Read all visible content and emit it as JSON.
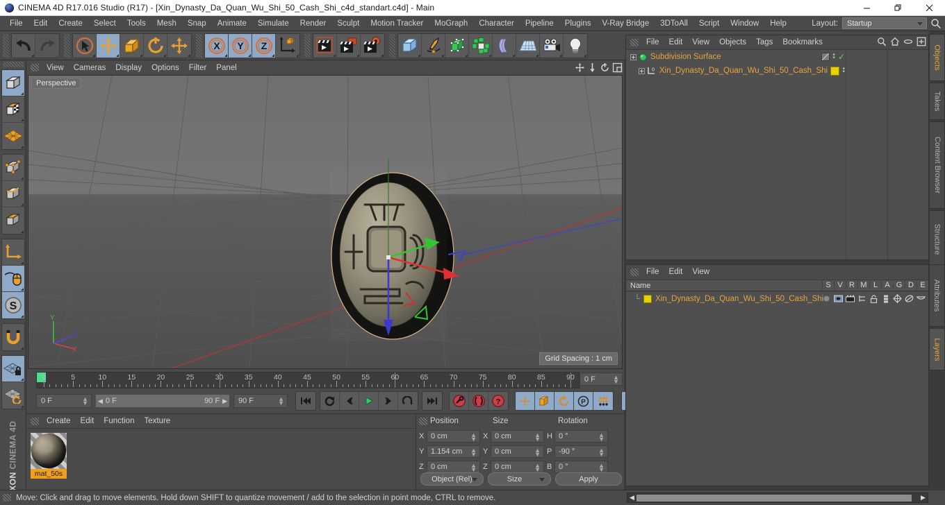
{
  "window": {
    "title": "CINEMA 4D R17.016 Studio (R17) - [Xin_Dynasty_Da_Quan_Wu_Shi_50_Cash_Shi_c4d_standart.c4d] - Main",
    "minimize": "—",
    "maximize": "❐",
    "close": "✕"
  },
  "menubar": {
    "items": [
      "File",
      "Edit",
      "Create",
      "Select",
      "Tools",
      "Mesh",
      "Snap",
      "Animate",
      "Simulate",
      "Render",
      "Sculpt",
      "Motion Tracker",
      "MoGraph",
      "Character",
      "Pipeline",
      "Plugins",
      "V-Ray Bridge",
      "3DToAll",
      "Script",
      "Window",
      "Help"
    ],
    "layout_label": "Layout:",
    "layout_value": "Startup",
    "search_icon": "search-icon"
  },
  "toolbar": {
    "groups": [
      {
        "name": "undo-redo",
        "buttons": [
          {
            "name": "undo-button",
            "icon": "undo-arrow-icon",
            "state": "normal"
          },
          {
            "name": "redo-button",
            "icon": "redo-arrow-icon",
            "state": "disabled"
          }
        ]
      },
      {
        "name": "transform-tools",
        "buttons": [
          {
            "name": "live-selection-tool",
            "icon": "cursor-circle-icon",
            "state": "normal"
          },
          {
            "name": "move-tool",
            "icon": "move-arrows-icon",
            "state": "active"
          },
          {
            "name": "scale-tool",
            "icon": "scale-box-icon",
            "state": "normal"
          },
          {
            "name": "rotate-tool",
            "icon": "rotate-circle-icon",
            "state": "normal"
          },
          {
            "name": "dynamic-place-tool",
            "icon": "move-arrows-icon",
            "state": "normal"
          }
        ]
      },
      {
        "name": "axis-locks",
        "buttons": [
          {
            "name": "lock-x-axis",
            "icon": "x-axis-icon",
            "state": "active"
          },
          {
            "name": "lock-y-axis",
            "icon": "y-axis-icon",
            "state": "active"
          },
          {
            "name": "lock-z-axis",
            "icon": "z-axis-icon",
            "state": "active"
          },
          {
            "name": "world-object-coords",
            "icon": "world-axis-icon",
            "state": "normal"
          }
        ]
      },
      {
        "name": "render-tools",
        "buttons": [
          {
            "name": "render-view-button",
            "icon": "render-clapper-icon",
            "state": "normal"
          },
          {
            "name": "render-region-button",
            "icon": "render-region-icon",
            "state": "normal"
          },
          {
            "name": "render-settings-button",
            "icon": "render-settings-icon",
            "state": "normal"
          }
        ]
      },
      {
        "name": "create-objects",
        "buttons": [
          {
            "name": "add-cube-button",
            "icon": "cube-icon",
            "state": "normal"
          },
          {
            "name": "add-spline-button",
            "icon": "pen-spline-icon",
            "state": "normal"
          },
          {
            "name": "add-nurbs-button",
            "icon": "green-cube-icon",
            "state": "normal"
          },
          {
            "name": "add-array-button",
            "icon": "array-icon",
            "state": "normal"
          },
          {
            "name": "add-deformer-button",
            "icon": "bend-deformer-icon",
            "state": "normal"
          },
          {
            "name": "add-scene-button",
            "icon": "floor-grid-icon",
            "state": "normal"
          },
          {
            "name": "add-camera-button",
            "icon": "camera-icon",
            "state": "normal"
          },
          {
            "name": "add-light-button",
            "icon": "light-bulb-icon",
            "state": "normal"
          }
        ]
      }
    ]
  },
  "left_palette": {
    "groups": [
      {
        "buttons": [
          {
            "name": "model-mode-button",
            "icon": "model-cube-icon",
            "state": "active"
          },
          {
            "name": "texture-mode-button",
            "icon": "texture-cube-icon",
            "state": "normal"
          },
          {
            "name": "workplane-mode-button",
            "icon": "workplane-grid-icon",
            "state": "normal"
          }
        ]
      },
      {
        "buttons": [
          {
            "name": "points-mode-button",
            "icon": "points-cube-icon",
            "state": "normal"
          },
          {
            "name": "edges-mode-button",
            "icon": "edges-cube-icon",
            "state": "normal"
          },
          {
            "name": "polygons-mode-button",
            "icon": "polygons-cube-icon",
            "state": "normal"
          }
        ]
      },
      {
        "buttons": [
          {
            "name": "object-axis-mode-button",
            "icon": "axis-corner-icon",
            "state": "normal"
          },
          {
            "name": "viewport-solo-button",
            "icon": "mouse-icon",
            "state": "active"
          },
          {
            "name": "enable-snap-button",
            "icon": "s-circle-icon",
            "state": "active"
          }
        ]
      },
      {
        "buttons": [
          {
            "name": "magnet-tool-button",
            "icon": "magnet-icon",
            "state": "normal"
          }
        ]
      },
      {
        "buttons": [
          {
            "name": "lock-workplane-button",
            "icon": "workplane-lock-icon",
            "state": "active"
          },
          {
            "name": "planar-workplane-button",
            "icon": "workplane-rotate-icon",
            "state": "normal"
          }
        ]
      }
    ],
    "brand_line1": "MAXON",
    "brand_line2": "CINEMA 4D"
  },
  "viewport": {
    "menus": [
      "View",
      "Cameras",
      "Display",
      "Options",
      "Filter",
      "Panel"
    ],
    "perspective_label": "Perspective",
    "grid_spacing": "Grid Spacing : 1 cm",
    "corner_icons": [
      "pan-view-icon",
      "dolly-view-icon",
      "rotate-view-icon",
      "maximize-view-icon"
    ],
    "axis_gizmo": {
      "x": "X",
      "y": "Y",
      "z": "Z",
      "x_color": "#d84040",
      "y_color": "#40c040",
      "z_color": "#4040e0"
    }
  },
  "timeline": {
    "tick_labels": [
      "0",
      "5",
      "10",
      "15",
      "20",
      "25",
      "30",
      "35",
      "40",
      "45",
      "50",
      "55",
      "60",
      "65",
      "70",
      "75",
      "80",
      "85",
      "90"
    ],
    "tick_values": [
      0,
      5,
      10,
      15,
      20,
      25,
      30,
      35,
      40,
      45,
      50,
      55,
      60,
      65,
      70,
      75,
      80,
      85,
      90
    ],
    "current_frame_right": "0 F",
    "current_frame": "0 F",
    "range_start": "0 F",
    "range_end": "90 F",
    "max_frame": "90 F",
    "playhead_frame": 0,
    "transport": [
      {
        "name": "go-to-start-button",
        "icon": "skip-start-icon"
      },
      {
        "name": "play-backwards-button",
        "icon": "loop-icon"
      },
      {
        "name": "step-back-button",
        "icon": "prev-frame-icon"
      },
      {
        "name": "play-button",
        "icon": "play-icon"
      },
      {
        "name": "step-forward-button",
        "icon": "next-frame-icon"
      },
      {
        "name": "play-forward-loop-button",
        "icon": "loop-forward-icon"
      },
      {
        "name": "go-to-end-button",
        "icon": "skip-end-icon"
      }
    ],
    "keyframe_tools": [
      {
        "name": "record-keyframe-button",
        "icon": "record-key-icon"
      },
      {
        "name": "autokey-button",
        "icon": "autokey-icon"
      },
      {
        "name": "keyframe-selection-button",
        "icon": "question-key-icon"
      }
    ],
    "key_toggles": [
      {
        "name": "key-position-button",
        "icon": "key-position-icon",
        "state": "active"
      },
      {
        "name": "key-scale-button",
        "icon": "key-scale-icon",
        "state": "active"
      },
      {
        "name": "key-rotation-button",
        "icon": "key-rotation-icon",
        "state": "active"
      },
      {
        "name": "key-param-button",
        "icon": "key-param-icon",
        "state": "active"
      },
      {
        "name": "key-pla-button",
        "icon": "key-point-level-icon",
        "state": "active"
      }
    ],
    "filmstrip_button": {
      "name": "animation-mode-button",
      "icon": "filmstrip-icon",
      "state": "active"
    }
  },
  "material_manager": {
    "menus": [
      "Create",
      "Edit",
      "Function",
      "Texture"
    ],
    "materials": [
      {
        "name": "mat_50s",
        "selected": true
      }
    ]
  },
  "coordinates": {
    "headers": [
      "Position",
      "Size",
      "Rotation"
    ],
    "rows": [
      {
        "pos_axis": "X",
        "pos_value": "0 cm",
        "size_axis": "X",
        "size_value": "0 cm",
        "rot_axis": "H",
        "rot_value": "0 °"
      },
      {
        "pos_axis": "Y",
        "pos_value": "1.154 cm",
        "size_axis": "Y",
        "size_value": "0 cm",
        "rot_axis": "P",
        "rot_value": "-90 °"
      },
      {
        "pos_axis": "Z",
        "pos_value": "0 cm",
        "size_axis": "Z",
        "size_value": "0 cm",
        "rot_axis": "B",
        "rot_value": "0 °"
      }
    ],
    "coord_system": "Object (Rel)",
    "size_mode": "Size",
    "apply_label": "Apply"
  },
  "object_manager": {
    "menus": [
      "File",
      "Edit",
      "View",
      "Objects",
      "Tags",
      "Bookmarks"
    ],
    "header_icons": [
      "search-icon",
      "home-icon",
      "eye-icon",
      "plus-box-icon"
    ],
    "rows": [
      {
        "name": "Subdivision Surface",
        "indent": 0,
        "icon": "subdivision-surface-icon",
        "tag_color": "none",
        "checked": true
      },
      {
        "name": "Xin_Dynasty_Da_Quan_Wu_Shi_50_Cash_Shi",
        "indent": 1,
        "icon": "polygon-object-icon",
        "tag_color": "#e8d000",
        "checked": false
      }
    ]
  },
  "layer_manager": {
    "menus": [
      "File",
      "Edit",
      "View"
    ],
    "columns": [
      "Name",
      "S",
      "V",
      "R",
      "M",
      "L",
      "A",
      "G",
      "D",
      "E"
    ],
    "rows": [
      {
        "name": "Xin_Dynasty_Da_Quan_Wu_Shi_50_Cash_Shi",
        "color": "#e8d000"
      }
    ]
  },
  "vertical_tabs": {
    "top": [
      {
        "label": "Objects",
        "selected": true
      },
      {
        "label": "Takes",
        "selected": false
      },
      {
        "label": "Content Browser",
        "selected": false
      },
      {
        "label": "Structure",
        "selected": false
      }
    ],
    "bottom": [
      {
        "label": "Attributes",
        "selected": false
      },
      {
        "label": "Layers",
        "selected": true
      }
    ]
  },
  "statusbar": {
    "message": "Move: Click and drag to move elements. Hold down SHIFT to quantize movement / add to the selection in point mode, CTRL to remove."
  }
}
